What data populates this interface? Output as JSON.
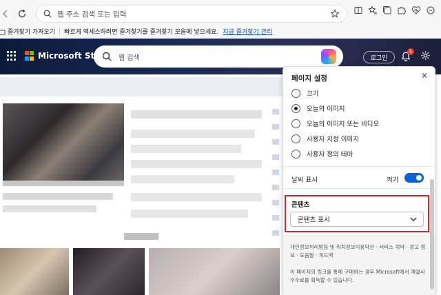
{
  "toolbar": {
    "address_placeholder": "웹 주소 검색 또는 입력"
  },
  "bookmarks": {
    "import_label": "즐겨찾기 가져오기",
    "hint": "빠르게 액세스하려면 즐겨찾기를 즐겨찾기 모음에 넣으세요.",
    "manage_link": "지금 즐겨찾기 관리"
  },
  "header": {
    "brand": "Microsoft Start",
    "search_placeholder": "웹 검색",
    "login_label": "로그인",
    "notification_count": "5"
  },
  "settings_panel": {
    "title": "페이지 설정",
    "options": [
      {
        "label": "끄기",
        "selected": false
      },
      {
        "label": "오늘의 이미지",
        "selected": true
      },
      {
        "label": "오늘의 이미지 또는 비디오",
        "selected": false
      },
      {
        "label": "사용자 지정 이미지",
        "selected": false
      },
      {
        "label": "사용자 정의 테마",
        "selected": false
      }
    ],
    "weather_label": "날씨 표시",
    "weather_toggle_label": "켜기",
    "weather_on": true,
    "contents_label": "콘텐츠",
    "contents_value": "콘텐츠 표시",
    "footer_links": "개인정보처리방침 및 위치정보이용약관 · 서비스 계약 · 광고 정보 · 도움말 · 피드백",
    "footer_note": "이 페이지의 링크를 통해 구매하는 경우 Microsoft에서 계열사 수수료를 획득할 수 있습니다."
  },
  "colors": {
    "accent": "#0a62d6",
    "highlight_border": "#d6242c",
    "header_bg": "#1a2b57"
  }
}
